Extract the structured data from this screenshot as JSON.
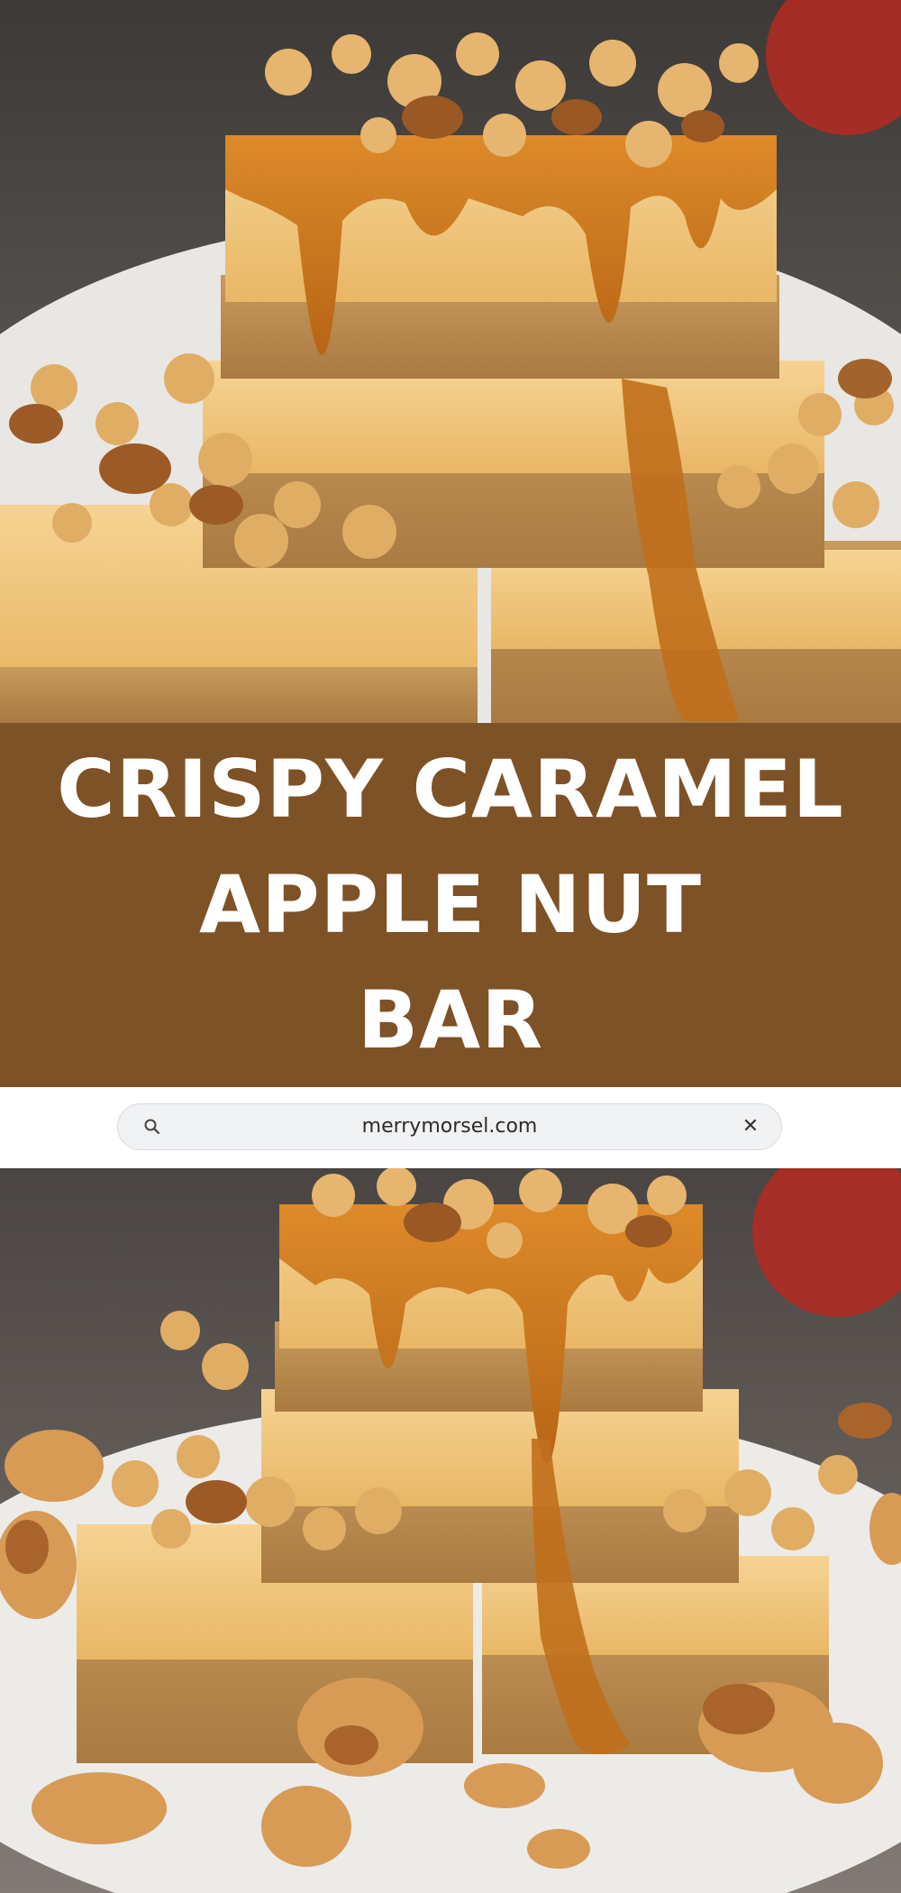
{
  "banner": {
    "title_lines": [
      "CRISPY CARAMEL",
      "APPLE NUT",
      "BAR"
    ],
    "background_color": "#7d5227",
    "text_color": "#ffffff"
  },
  "search_bar": {
    "icon": "search-icon",
    "text": "merrymorsel.com",
    "clear_icon": "close-icon",
    "clear_glyph": "✕"
  },
  "photos": {
    "top": {
      "subject": "stack of caramel apple nut bars on a white plate"
    },
    "bottom": {
      "subject": "caramel apple nut bars with scattered nuts on a white plate"
    }
  },
  "colors": {
    "caramel": "#c9761f",
    "custard": "#f0c984",
    "crust": "#b98a4e",
    "nut": "#a8642a",
    "plate": "#ececea",
    "background": "#5a4f48"
  }
}
